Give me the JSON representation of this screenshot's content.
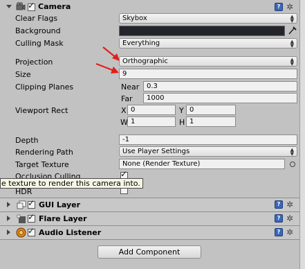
{
  "camera": {
    "title": "Camera",
    "enabled": true,
    "fields": {
      "clear_flags": {
        "label": "Clear Flags",
        "value": "Skybox"
      },
      "background": {
        "label": "Background",
        "color": "#23252b"
      },
      "culling_mask": {
        "label": "Culling Mask",
        "value": "Everything"
      },
      "projection": {
        "label": "Projection",
        "value": "Orthographic"
      },
      "size": {
        "label": "Size",
        "value": "9"
      },
      "clipping_planes": {
        "label": "Clipping Planes",
        "near_label": "Near",
        "near_value": "0.3",
        "far_label": "Far",
        "far_value": "1000"
      },
      "viewport_rect": {
        "label": "Viewport Rect",
        "x_label": "X",
        "x_value": "0",
        "y_label": "Y",
        "y_value": "0",
        "w_label": "W",
        "w_value": "1",
        "h_label": "H",
        "h_value": "1"
      },
      "depth": {
        "label": "Depth",
        "value": "-1"
      },
      "rendering_path": {
        "label": "Rendering Path",
        "value": "Use Player Settings"
      },
      "target_texture": {
        "label": "Target Texture",
        "value": "None (Render Texture)"
      },
      "occlusion_culling": {
        "label": "Occlusion Culling",
        "checked": true
      },
      "hdr": {
        "label": "HDR",
        "checked": false
      }
    },
    "tooltip": "e texture to render this camera into."
  },
  "components": [
    {
      "title": "GUI Layer",
      "enabled": true
    },
    {
      "title": "Flare Layer",
      "enabled": true
    },
    {
      "title": "Audio Listener",
      "enabled": true
    }
  ],
  "add_component": {
    "label": "Add Component"
  },
  "annotation_color": "#e0201a"
}
